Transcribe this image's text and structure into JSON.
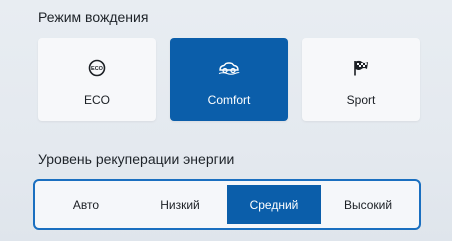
{
  "drive_mode": {
    "title": "Режим вождения",
    "modes": [
      {
        "label": "ECO",
        "icon": "eco-icon",
        "selected": false
      },
      {
        "label": "Comfort",
        "icon": "car-comfort-icon",
        "selected": true
      },
      {
        "label": "Sport",
        "icon": "checkered-flag-icon",
        "selected": false
      }
    ]
  },
  "regen": {
    "title": "Уровень рекуперации энергии",
    "options": [
      {
        "label": "Авто",
        "selected": false
      },
      {
        "label": "Низкий",
        "selected": false
      },
      {
        "label": "Средний",
        "selected": true
      },
      {
        "label": "Высокий",
        "selected": false
      }
    ]
  },
  "colors": {
    "accent": "#0b5eaa",
    "card": "#f7f8fa",
    "background": "#e6ebf0"
  }
}
